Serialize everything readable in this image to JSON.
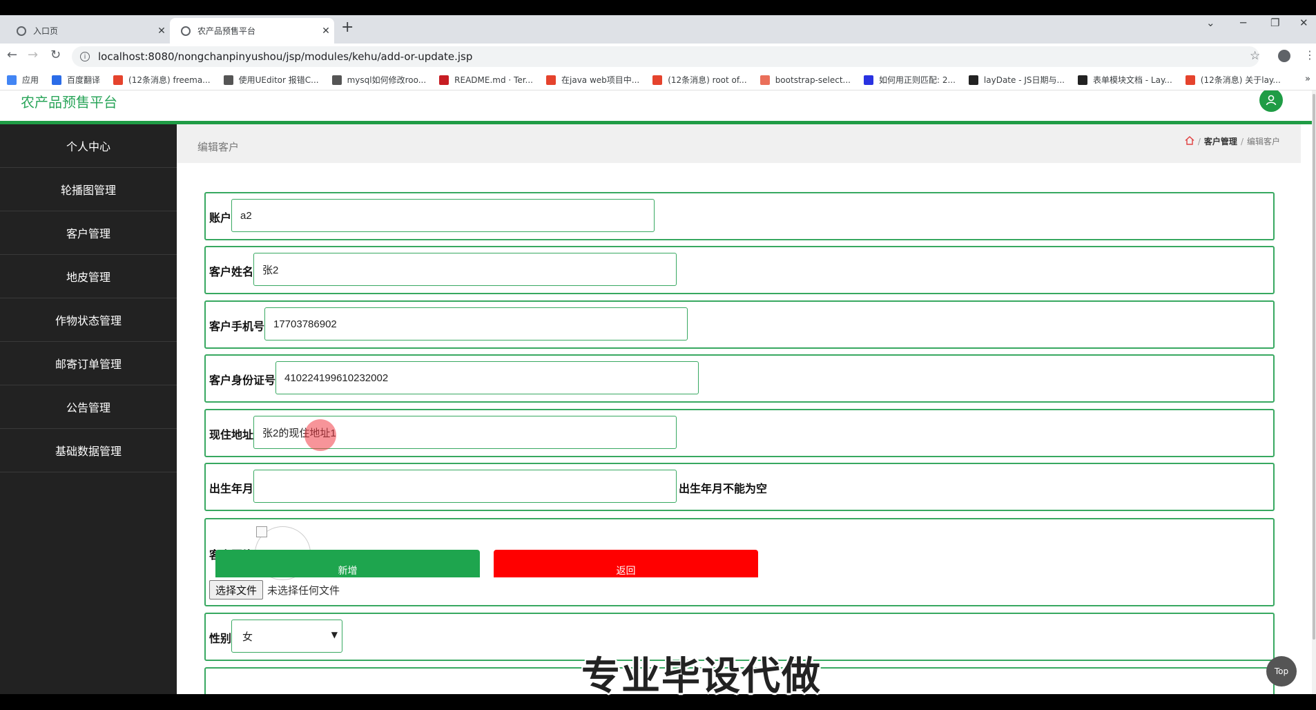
{
  "browser": {
    "tabs": [
      {
        "title": "入口页"
      },
      {
        "title": "农产品预售平台"
      }
    ],
    "url": "localhost:8080/nongchanpinyushou/jsp/modules/kehu/add-or-update.jsp",
    "bookmarks": [
      {
        "label": "应用",
        "icon": "apps-grid-icon",
        "color": "#4285f4"
      },
      {
        "label": "百度翻译",
        "icon": "baidu-translate-icon",
        "color": "#2b6ce8"
      },
      {
        "label": "(12条消息) freema...",
        "icon": "csdn-icon",
        "color": "#e5432d"
      },
      {
        "label": "使用UEditor 报错C...",
        "icon": "fork-icon",
        "color": "#555555"
      },
      {
        "label": "mysql如何修改roo...",
        "icon": "fork-icon",
        "color": "#555555"
      },
      {
        "label": "README.md · Ter...",
        "icon": "gitee-icon",
        "color": "#c71d23"
      },
      {
        "label": "在java web项目中...",
        "icon": "csdn-icon",
        "color": "#e5432d"
      },
      {
        "label": "(12条消息) root of...",
        "icon": "csdn-icon",
        "color": "#e5432d"
      },
      {
        "label": "bootstrap-select...",
        "icon": "jianshu-icon",
        "color": "#ea6f5a"
      },
      {
        "label": "如何用正则匹配: 2...",
        "icon": "baidu-paw-icon",
        "color": "#2932e1"
      },
      {
        "label": "layDate - JS日期与...",
        "icon": "layui-icon",
        "color": "#222222"
      },
      {
        "label": "表单模块文档 - Lay...",
        "icon": "layui-icon",
        "color": "#222222"
      },
      {
        "label": "(12条消息) 关于lay...",
        "icon": "csdn-icon",
        "color": "#e5432d"
      }
    ],
    "more_bookmarks": "»"
  },
  "app": {
    "logo": "农产品预售平台",
    "accent": "#1f9c45"
  },
  "sidebar": {
    "items": [
      {
        "label": "个人中心"
      },
      {
        "label": "轮播图管理"
      },
      {
        "label": "客户管理"
      },
      {
        "label": "地皮管理"
      },
      {
        "label": "作物状态管理"
      },
      {
        "label": "邮寄订单管理"
      },
      {
        "label": "公告管理"
      },
      {
        "label": "基础数据管理"
      }
    ]
  },
  "page": {
    "title": "编辑客户",
    "breadcrumb": {
      "sep": "/",
      "parent": "客户管理",
      "current": "编辑客户"
    }
  },
  "form": {
    "account": {
      "label": "账户",
      "value": "a2"
    },
    "name": {
      "label": "客户姓名",
      "value": "张2"
    },
    "phone": {
      "label": "客户手机号",
      "value": "17703786902"
    },
    "id_card": {
      "label": "客户身份证号",
      "value": "410224199610232002"
    },
    "address": {
      "label": "现住地址",
      "value": "张2的现住地址1"
    },
    "birth": {
      "label": "出生年月",
      "value": "",
      "error": "出生年月不能为空"
    },
    "photo": {
      "label": "客户照片",
      "file_button": "选择文件",
      "file_status": "未选择任何文件"
    },
    "sex": {
      "label": "性别",
      "value": "女"
    },
    "add_button": "新增",
    "back_button": "返回"
  },
  "overlay": {
    "watermark": "专业毕设代做",
    "top_button": "Top"
  }
}
